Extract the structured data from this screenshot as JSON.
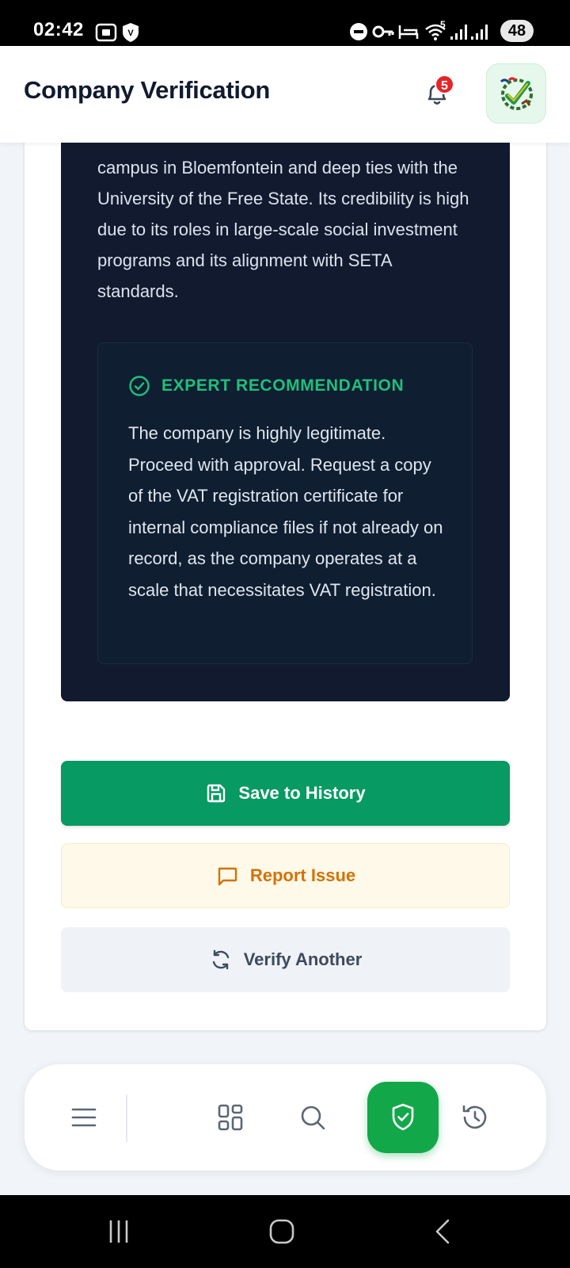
{
  "status_bar": {
    "time": "02:42",
    "battery": "48",
    "signal_label": "5"
  },
  "header": {
    "title": "Company Verification",
    "notification_count": "5"
  },
  "analysis": {
    "text": "campus in Bloemfontein and deep ties with the University of the Free State. Its credibility is high due to its roles in large-scale social investment programs and its alignment with SETA standards."
  },
  "expert_recommendation": {
    "heading": "EXPERT RECOMMENDATION",
    "text": "The company is highly legitimate. Proceed with approval. Request a copy of the VAT registration certificate for internal compliance files if not already on record, as the company operates at a scale that necessitates VAT registration."
  },
  "actions": {
    "save_label": "Save to History",
    "report_label": "Report Issue",
    "verify_label": "Verify Another"
  },
  "bottom_nav": {
    "items": [
      "menu-icon",
      "dashboard-icon",
      "search-icon",
      "shield-check-icon",
      "history-icon"
    ],
    "active": "shield-check-icon"
  },
  "colors": {
    "primary_green": "#079a63",
    "accent_green": "#1fbf7d",
    "report_orange": "#d37206",
    "dark_panel": "#121a2f",
    "badge_red": "#e5252a"
  }
}
